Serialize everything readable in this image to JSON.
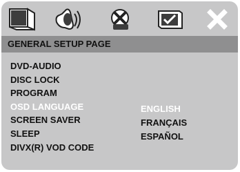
{
  "tabs": [
    {
      "icon": "general-setup-icon"
    },
    {
      "icon": "audio-setup-icon"
    },
    {
      "icon": "video-setup-icon"
    },
    {
      "icon": "preference-setup-icon"
    },
    {
      "icon": "close-icon"
    }
  ],
  "page_title": "GENERAL SETUP PAGE",
  "menu_items": [
    "DVD-AUDIO",
    "DISC LOCK",
    "PROGRAM",
    "OSD LANGUAGE",
    "SCREEN SAVER",
    "SLEEP",
    "DIVX(R) VOD CODE"
  ],
  "active_item": "OSD LANGUAGE",
  "language_options": [
    "ENGLISH",
    "FRANÇAIS",
    "ESPAÑOL"
  ],
  "selected_option": "ENGLISH",
  "colors": {
    "background": "#c7c7c8",
    "title_bar": "#8f8f90",
    "text": "#111111",
    "highlight_text": "#ffffff"
  }
}
